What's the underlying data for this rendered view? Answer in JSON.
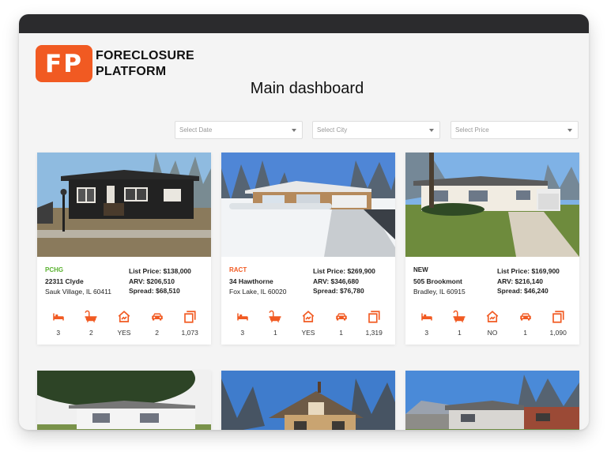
{
  "brand": {
    "mark": "FP",
    "line1": "FORECLOSURE",
    "line2": "PLATFORM",
    "accent": "#f15a22"
  },
  "page": {
    "title": "Main dashboard"
  },
  "filters": {
    "date_placeholder": "Select Date",
    "city_placeholder": "Select City",
    "price_placeholder": "Select Price"
  },
  "colors": {
    "pchg": "#5ab230",
    "ract": "#f15a22",
    "new": "#222222",
    "icon": "#f15a22"
  },
  "listings": [
    {
      "status": "PCHG",
      "address": "22311 Clyde",
      "city": "Sauk Village, IL 60411",
      "list_price": "List Price: $138,000",
      "arv": "ARV: $206,510",
      "spread": "Spread: $68,510",
      "beds": "3",
      "baths": "2",
      "basement": "YES",
      "garage": "2",
      "sqft": "1,073"
    },
    {
      "status": "RACT",
      "address": "34 Hawthorne",
      "city": "Fox Lake, IL 60020",
      "list_price": "List Price: $269,900",
      "arv": "ARV: $346,680",
      "spread": "Spread: $76,780",
      "beds": "3",
      "baths": "1",
      "basement": "YES",
      "garage": "1",
      "sqft": "1,319"
    },
    {
      "status": "NEW",
      "address": "505 Brookmont",
      "city": "Bradley, IL 60915",
      "list_price": "List Price: $169,900",
      "arv": "ARV: $216,140",
      "spread": "Spread: $46,240",
      "beds": "3",
      "baths": "1",
      "basement": "NO",
      "garage": "1",
      "sqft": "1,090"
    }
  ],
  "feature_icons": [
    "bed-icon",
    "bathtub-icon",
    "house-basement-icon",
    "car-icon",
    "floor-plan-icon"
  ]
}
